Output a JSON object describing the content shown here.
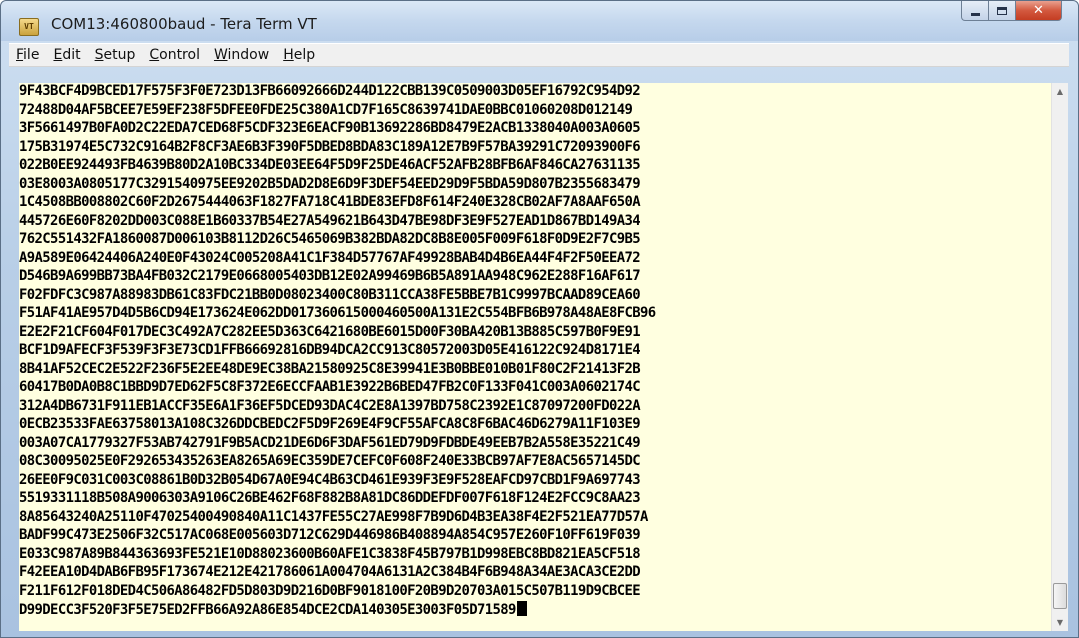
{
  "window": {
    "title": "COM13:460800baud - Tera Term VT",
    "app_icon": "teraterm-app-icon",
    "buttons": {
      "minimize": "minimize-icon",
      "maximize": "maximize-icon",
      "close": "close-icon"
    }
  },
  "menu": [
    {
      "acc": "F",
      "rest": "ile"
    },
    {
      "acc": "E",
      "rest": "dit"
    },
    {
      "acc": "S",
      "rest": "etup"
    },
    {
      "acc": "C",
      "rest": "ontrol"
    },
    {
      "acc": "W",
      "rest": "indow"
    },
    {
      "acc": "H",
      "rest": "elp"
    }
  ],
  "terminal": {
    "background": "#ffffe0",
    "foreground": "#000000",
    "lines": [
      "9F43BCF4D9BCED17F575F3F0E723D13FB66092666D244D122CBB139C0509003D05EF16792C954D92",
      "72488D04AF5BCEE7E59EF238F5DFEE0FDE25C380A1CD7F165C8639741DAE0BBC01060208D012149",
      "3F5661497B0FA0D2C22EDA7CED68F5CDF323E6EACF90B13692286BD8479E2ACB1338040A003A0605",
      "175B31974E5C732C9164B2F8CF3AE6B3F390F5DBED8BDA83C189A12E7B9F57BA39291C72093900F6",
      "022B0EE924493FB4639B80D2A10BC334DE03EE64F5D9F25DE46ACF52AFB28BFB6AF846CA27631135",
      "03E8003A0805177C3291540975EE9202B5DAD2D8E6D9F3DEF54EED29D9F5BDA59D807B2355683479",
      "1C4508BB008802C60F2D2675444063F1827FA718C41BDE83EFD8F614F240E328CB02AF7A8AAF650A",
      "445726E60F8202DD003C088E1B60337B54E27A549621B643D47BE98DF3E9F527EAD1D867BD149A34",
      "762C551432FA1860087D006103B8112D26C5465069B382BDA82DC8B8E005F009F618F0D9E2F7C9B5",
      "A9A589E06424406A240E0F43024C005208A41C1F384D57767AF49928BAB4D4B6EA44F4F2F50EEA72",
      "D546B9A699BB73BA4FB032C2179E0668005403DB12E02A99469B6B5A891AA948C962E288F16AF617",
      "F02FDFC3C987A88983DB61C83FDC21BB0D08023400C80B311CCA38FE5BBE7B1C9997BCAAD89CEA60",
      "F51AF41AE957D4D5B6CD94E173624E062DD017360615000460500A131E2C554BFB6B978A48AE8FCB96",
      "E2E2F21CF604F017DEC3C492A7C282EE5D363C6421680BE6015D00F30BA420B13B885C597B0F9E91",
      "BCF1D9AFECF3F539F3F3E73CD1FFB66692816DB94DCA2CC913C80572003D05E416122C924D8171E4",
      "8B41AF52CEC2E522F236F5E2EE48DE9EC38BA21580925C8E39941E3B0BBE010B01F80C2F21413F2B",
      "60417B0DA0B8C1BBD9D7ED62F5C8F372E6ECCFAAB1E3922B6BED47FB2C0F133F041C003A0602174C",
      "312A4DB6731F911EB1ACCF35E6A1F36EF5DCED93DAC4C2E8A1397BD758C2392E1C87097200FD022A",
      "0ECB23533FAE63758013A108C326DDCBEDC2F5D9F269E4F9CF55AFCA8C8F6BAC46D6279A11F103E9",
      "003A07CA1779327F53AB742791F9B5ACD21DE6D6F3DAF561ED79D9FDBDE49EEB7B2A558E35221C49",
      "08C30095025E0F292653435263EA8265A69EC359DE7CEFC0F608F240E33BCB97AF7E8AC5657145DC",
      "26EE0F9C031C003C08861B0D32B054D67A0E94C4B63CD461E939F3E9F528EAFCD97CBD1F9A697743",
      "5519331118B508A9006303A9106C26BE462F68F882B8A81DC86DDEFDF007F618F124E2FCC9C8AA23",
      "8A85643240A25110F47025400490840A11C1437FE55C27AE998F7B9D6D4B3EA38F4E2F521EA77D57A",
      "BADF99C473E2506F32C517AC068E005603D712C629D446986B408894A854C957E260F10FF619F039",
      "E033C987A89B844363693FE521E10D88023600B60AFE1C3838F45B797B1D998EBC8BD821EA5CF518",
      "F42EEA10D4DAB6FB95F173674E212E421786061A004704A6131A2C384B4F6B948A34AE3ACA3CE2DD",
      "F211F612F018DED4C506A86482FD5D803D9D216D0BF9018100F20B9D20703A015C507B119D9CBCEE",
      "D99DECC3F520F3F5E75ED2FFB66A92A86E854DCE2CDA140305E3003F05D71589"
    ]
  }
}
